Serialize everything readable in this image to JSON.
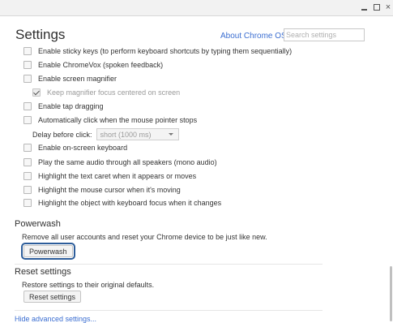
{
  "window": {
    "minimize": "_",
    "close": "×"
  },
  "header": {
    "title": "Settings",
    "about_link": "About Chrome OS",
    "search_placeholder": "Search settings"
  },
  "accessibility": {
    "options": [
      {
        "label": "Enable sticky keys (to perform keyboard shortcuts by typing them sequentially)",
        "checked": false
      },
      {
        "label": "Enable ChromeVox (spoken feedback)",
        "checked": false
      },
      {
        "label": "Enable screen magnifier",
        "checked": false
      },
      {
        "label": "Keep magnifier focus centered on screen",
        "checked": true,
        "disabled": true
      },
      {
        "label": "Enable tap dragging",
        "checked": false
      },
      {
        "label": "Automatically click when the mouse pointer stops",
        "checked": false
      },
      {
        "label": "Enable on-screen keyboard",
        "checked": false
      },
      {
        "label": "Play the same audio through all speakers (mono audio)",
        "checked": false
      },
      {
        "label": "Highlight the text caret when it appears or moves",
        "checked": false
      },
      {
        "label": "Highlight the mouse cursor when it's moving",
        "checked": false
      },
      {
        "label": "Highlight the object with keyboard focus when it changes",
        "checked": false
      }
    ],
    "delay_label": "Delay before click:",
    "delay_value": "short (1000 ms)"
  },
  "powerwash": {
    "heading": "Powerwash",
    "description": "Remove all user accounts and reset your Chrome device to be just like new.",
    "button": "Powerwash"
  },
  "reset": {
    "heading": "Reset settings",
    "description": "Restore settings to their original defaults.",
    "button": "Reset settings"
  },
  "footer": {
    "hide_advanced": "Hide advanced settings..."
  },
  "colors": {
    "link": "#3b6ed1",
    "focus_ring": "#2d5d9a"
  }
}
